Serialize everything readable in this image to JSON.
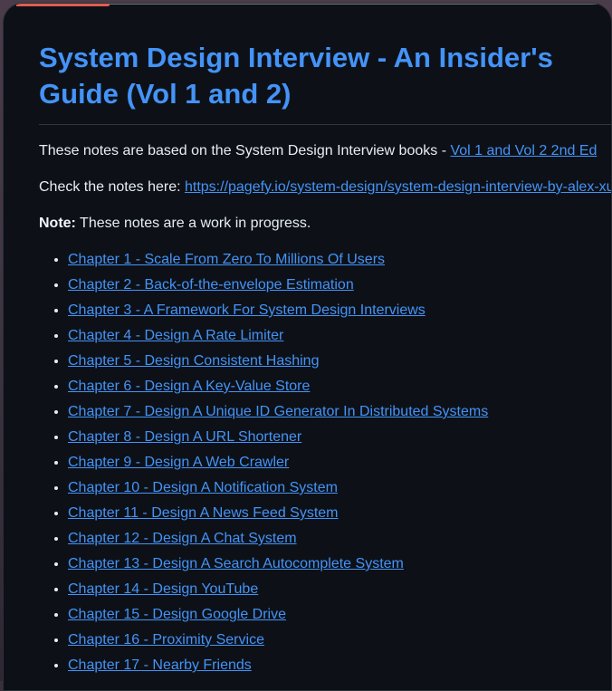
{
  "title": "System Design Interview - An Insider's Guide (Vol 1 and 2)",
  "intro": {
    "text": "These notes are based on the System Design Interview books - ",
    "link_label": "Vol 1 and Vol 2 2nd Ed"
  },
  "notes_link": {
    "text": "Check the notes here: ",
    "url_label": "https://pagefy.io/system-design/system-design-interview-by-alex-xu"
  },
  "note": {
    "label": "Note:",
    "text": " These notes are a work in progress."
  },
  "chapters": [
    "Chapter 1 - Scale From Zero To Millions Of Users",
    "Chapter 2 - Back-of-the-envelope Estimation",
    "Chapter 3 - A Framework For System Design Interviews",
    "Chapter 4 - Design A Rate Limiter",
    "Chapter 5 - Design Consistent Hashing",
    "Chapter 6 - Design A Key-Value Store",
    "Chapter 7 - Design A Unique ID Generator In Distributed Systems",
    "Chapter 8 - Design A URL Shortener",
    "Chapter 9 - Design A Web Crawler",
    "Chapter 10 - Design A Notification System",
    "Chapter 11 - Design A News Feed System",
    "Chapter 12 - Design A Chat System",
    "Chapter 13 - Design A Search Autocomplete System",
    "Chapter 14 - Design YouTube",
    "Chapter 15 - Design Google Drive",
    "Chapter 16 - Proximity Service",
    "Chapter 17 - Nearby Friends"
  ],
  "colors": {
    "background": "#0d1117",
    "link": "#4493f8",
    "text": "#e6edf3",
    "progress": "#e05d50"
  }
}
